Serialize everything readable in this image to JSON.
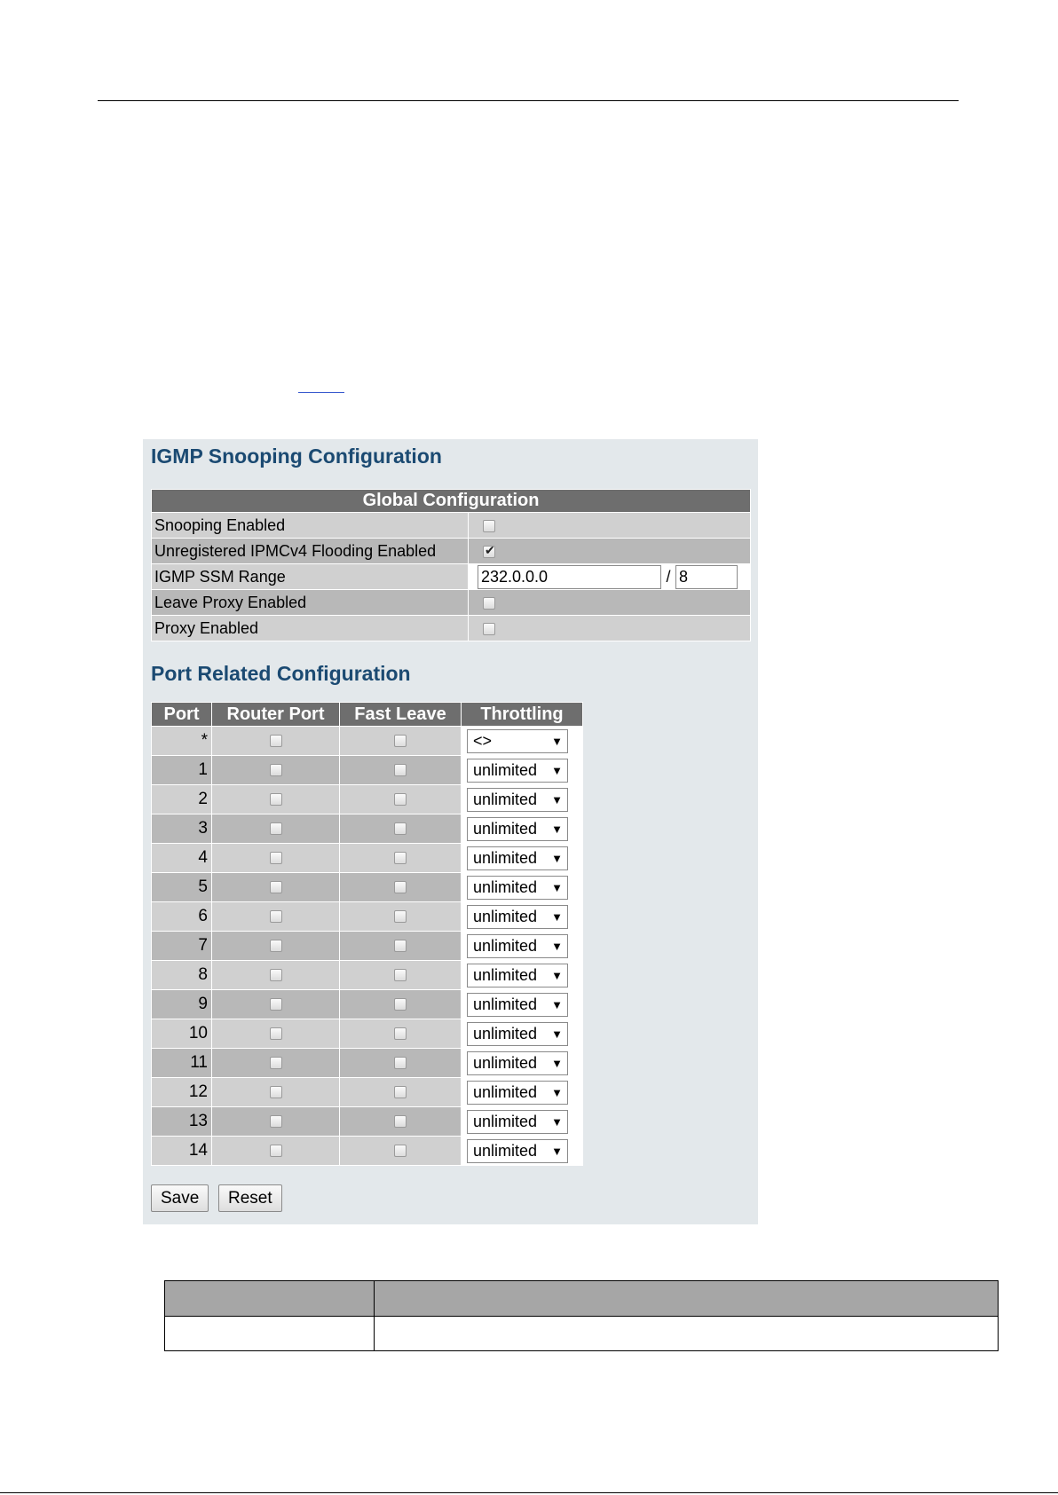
{
  "panel": {
    "title": "IGMP Snooping Configuration",
    "global": {
      "header": "Global Configuration",
      "rows": [
        {
          "label": "Snooping Enabled",
          "checked": false
        },
        {
          "label": "Unregistered IPMCv4 Flooding Enabled",
          "checked": true
        },
        {
          "label": "IGMP SSM Range",
          "ssm_address": "232.0.0.0",
          "ssm_separator": "/",
          "ssm_prefix": "8"
        },
        {
          "label": "Leave Proxy Enabled",
          "checked": false
        },
        {
          "label": "Proxy Enabled",
          "checked": false
        }
      ]
    },
    "port_section_title": "Port Related Configuration",
    "port_table": {
      "headers": [
        "Port",
        "Router Port",
        "Fast Leave",
        "Throttling"
      ],
      "rows": [
        {
          "port": "*",
          "throttling": "<>"
        },
        {
          "port": "1",
          "throttling": "unlimited"
        },
        {
          "port": "2",
          "throttling": "unlimited"
        },
        {
          "port": "3",
          "throttling": "unlimited"
        },
        {
          "port": "4",
          "throttling": "unlimited"
        },
        {
          "port": "5",
          "throttling": "unlimited"
        },
        {
          "port": "6",
          "throttling": "unlimited"
        },
        {
          "port": "7",
          "throttling": "unlimited"
        },
        {
          "port": "8",
          "throttling": "unlimited"
        },
        {
          "port": "9",
          "throttling": "unlimited"
        },
        {
          "port": "10",
          "throttling": "unlimited"
        },
        {
          "port": "11",
          "throttling": "unlimited"
        },
        {
          "port": "12",
          "throttling": "unlimited"
        },
        {
          "port": "13",
          "throttling": "unlimited"
        },
        {
          "port": "14",
          "throttling": "unlimited"
        }
      ]
    },
    "buttons": {
      "save": "Save",
      "reset": "Reset"
    }
  },
  "icons": {
    "dropdown": "chevron-down-icon",
    "check": "checkmark-icon"
  }
}
